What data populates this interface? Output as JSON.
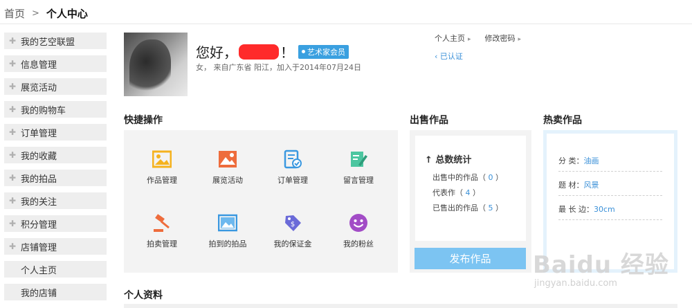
{
  "breadcrumb": {
    "home": "首页",
    "separator": ">",
    "current": "个人中心"
  },
  "sidebar": {
    "items": [
      {
        "label": "我的艺空联盟",
        "sub": false
      },
      {
        "label": "信息管理",
        "sub": false
      },
      {
        "label": "展览活动",
        "sub": false
      },
      {
        "label": "我的购物车",
        "sub": false
      },
      {
        "label": "订单管理",
        "sub": false
      },
      {
        "label": "我的收藏",
        "sub": false
      },
      {
        "label": "我的拍品",
        "sub": false
      },
      {
        "label": "我的关注",
        "sub": false
      },
      {
        "label": "积分管理",
        "sub": false
      },
      {
        "label": "店铺管理",
        "sub": false
      },
      {
        "label": "个人主页",
        "sub": true
      },
      {
        "label": "我的店铺",
        "sub": true
      }
    ]
  },
  "profile": {
    "greeting": "您好，",
    "exclaim": "！",
    "badge": "艺术家会员",
    "info": "女， 来自广东省  阳江，加入于2014年07月24日",
    "links": {
      "home": "个人主页",
      "password": "修改密码"
    },
    "verified": "已认证"
  },
  "quick": {
    "title": "快捷操作",
    "actions": [
      {
        "label": "作品管理",
        "icon": "picture-icon",
        "color": "#f5b21e"
      },
      {
        "label": "展览活动",
        "icon": "landscape-icon",
        "color": "#ee6c3c"
      },
      {
        "label": "订单管理",
        "icon": "order-check-icon",
        "color": "#3a98e0"
      },
      {
        "label": "留言管理",
        "icon": "edit-note-icon",
        "color": "#4cc6a0"
      },
      {
        "label": "拍卖管理",
        "icon": "gavel-icon",
        "color": "#ee6c3c"
      },
      {
        "label": "拍到的拍品",
        "icon": "image-frame-icon",
        "color": "#3a98e0"
      },
      {
        "label": "我的保证金",
        "icon": "price-tag-icon",
        "color": "#6a6ad8"
      },
      {
        "label": "我的粉丝",
        "icon": "smiley-icon",
        "color": "#a24cc6"
      }
    ]
  },
  "sale": {
    "title": "出售作品",
    "stats_head": "总数统计",
    "rows": [
      {
        "label": "出售中的作品",
        "value": "0"
      },
      {
        "label": "代表作",
        "value": "4"
      },
      {
        "label": "已售出的作品",
        "value": "5"
      }
    ],
    "publish": "发布作品"
  },
  "hot": {
    "title": "热卖作品",
    "rows": [
      {
        "label": "分 类：",
        "value": "油画"
      },
      {
        "label": "题 材：",
        "value": "风景"
      },
      {
        "label": "最 长 边：",
        "value": "30cm"
      }
    ]
  },
  "personal_title": "个人资料",
  "watermark": {
    "big": "Baidu 经验",
    "small": "jingyan.baidu.com"
  }
}
